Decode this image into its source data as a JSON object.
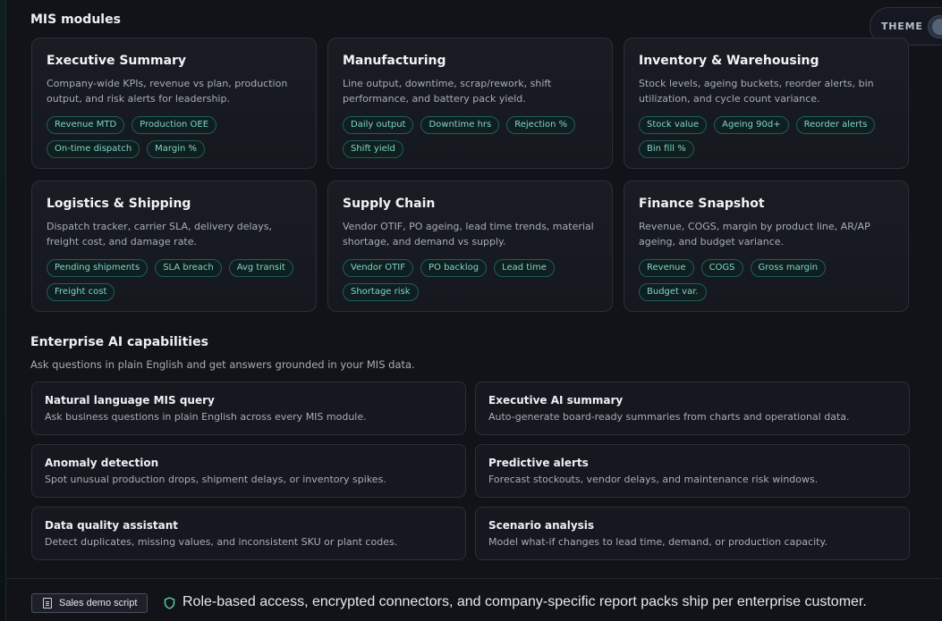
{
  "modules": {
    "title": "MIS modules",
    "cards": [
      {
        "title": "Executive Summary",
        "desc": "Company-wide KPIs, revenue vs plan, production output, and risk alerts for leadership.",
        "tags": [
          "Revenue MTD",
          "Production OEE",
          "On-time dispatch",
          "Margin %"
        ]
      },
      {
        "title": "Manufacturing",
        "desc": "Line output, downtime, scrap/rework, shift performance, and battery pack yield.",
        "tags": [
          "Daily output",
          "Downtime hrs",
          "Rejection %",
          "Shift yield"
        ]
      },
      {
        "title": "Inventory & Warehousing",
        "desc": "Stock levels, ageing buckets, reorder alerts, bin utilization, and cycle count variance.",
        "tags": [
          "Stock value",
          "Ageing 90d+",
          "Reorder alerts",
          "Bin fill %"
        ]
      },
      {
        "title": "Logistics & Shipping",
        "desc": "Dispatch tracker, carrier SLA, delivery delays, freight cost, and damage rate.",
        "tags": [
          "Pending shipments",
          "SLA breach",
          "Avg transit",
          "Freight cost"
        ]
      },
      {
        "title": "Supply Chain",
        "desc": "Vendor OTIF, PO ageing, lead time trends, material shortage, and demand vs supply.",
        "tags": [
          "Vendor OTIF",
          "PO backlog",
          "Lead time",
          "Shortage risk"
        ]
      },
      {
        "title": "Finance Snapshot",
        "desc": "Revenue, COGS, margin by product line, AR/AP ageing, and budget variance.",
        "tags": [
          "Revenue",
          "COGS",
          "Gross margin",
          "Budget var."
        ]
      }
    ]
  },
  "theme": {
    "label": "THEME"
  },
  "ai": {
    "title": "Enterprise AI capabilities",
    "subtitle": "Ask questions in plain English and get answers grounded in your MIS data.",
    "cards": [
      {
        "title": "Natural language MIS query",
        "desc": "Ask business questions in plain English across every MIS module."
      },
      {
        "title": "Executive AI summary",
        "desc": "Auto-generate board-ready summaries from charts and operational data."
      },
      {
        "title": "Anomaly detection",
        "desc": "Spot unusual production drops, shipment delays, or inventory spikes."
      },
      {
        "title": "Predictive alerts",
        "desc": "Forecast stockouts, vendor delays, and maintenance risk windows."
      },
      {
        "title": "Data quality assistant",
        "desc": "Detect duplicates, missing values, and inconsistent SKU or plant codes."
      },
      {
        "title": "Scenario analysis",
        "desc": "Model what-if changes to lead time, demand, or production capacity."
      }
    ]
  },
  "footer": {
    "demo_button": "Sales demo script",
    "note": "Role-based access, encrypted connectors, and company-specific report packs ship per enterprise customer."
  },
  "colors": {
    "accent": "#7fd6c8",
    "tag_border": "#1f5e57",
    "background": "#111318"
  }
}
